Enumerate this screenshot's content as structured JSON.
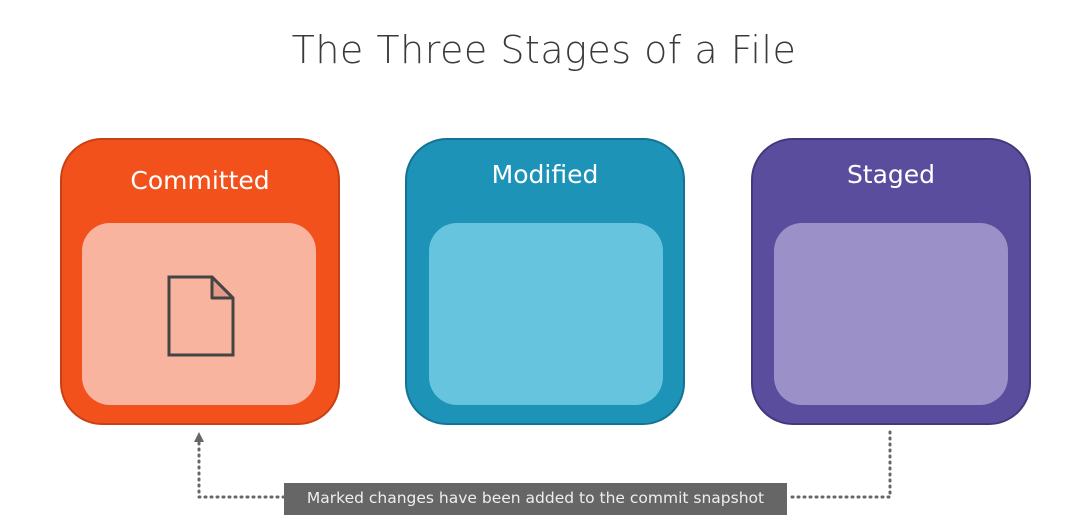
{
  "title": "The Three Stages of a File",
  "stages": [
    {
      "label": "Committed",
      "color": "#f2511b"
    },
    {
      "label": "Modified",
      "color": "#1e93b8"
    },
    {
      "label": "Staged",
      "color": "#5b4d9e"
    }
  ],
  "caption": "Marked changes have been added to the commit snapshot",
  "icons": {
    "file": "file-icon",
    "arrow": "arrow-up-icon"
  }
}
